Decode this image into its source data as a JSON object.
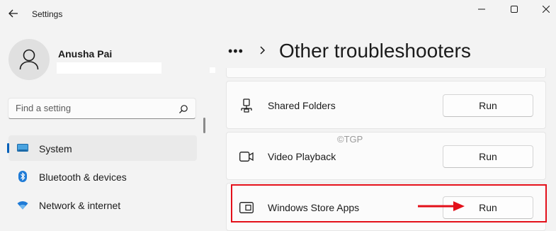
{
  "window": {
    "title": "Settings",
    "controls": [
      "minimize",
      "maximize",
      "close"
    ]
  },
  "user": {
    "name": "Anusha Pai"
  },
  "search": {
    "placeholder": "Find a setting"
  },
  "sidebar": {
    "items": [
      {
        "label": "System",
        "icon": "monitor-icon",
        "selected": true
      },
      {
        "label": "Bluetooth & devices",
        "icon": "bluetooth-icon",
        "selected": false
      },
      {
        "label": "Network & internet",
        "icon": "wifi-icon",
        "selected": false
      }
    ]
  },
  "breadcrumb": {
    "more": "•••",
    "title": "Other troubleshooters"
  },
  "troubleshooters": [
    {
      "label": "Shared Folders",
      "icon": "shared-folder-icon",
      "button": "Run"
    },
    {
      "label": "Video Playback",
      "icon": "video-camera-icon",
      "button": "Run"
    },
    {
      "label": "Windows Store Apps",
      "icon": "store-app-icon",
      "button": "Run",
      "highlighted": true
    }
  ],
  "watermark": "©TGP",
  "colors": {
    "accent": "#005fb8",
    "highlight": "#e3101a",
    "background": "#f3f3f3",
    "card": "#fbfbfb"
  }
}
